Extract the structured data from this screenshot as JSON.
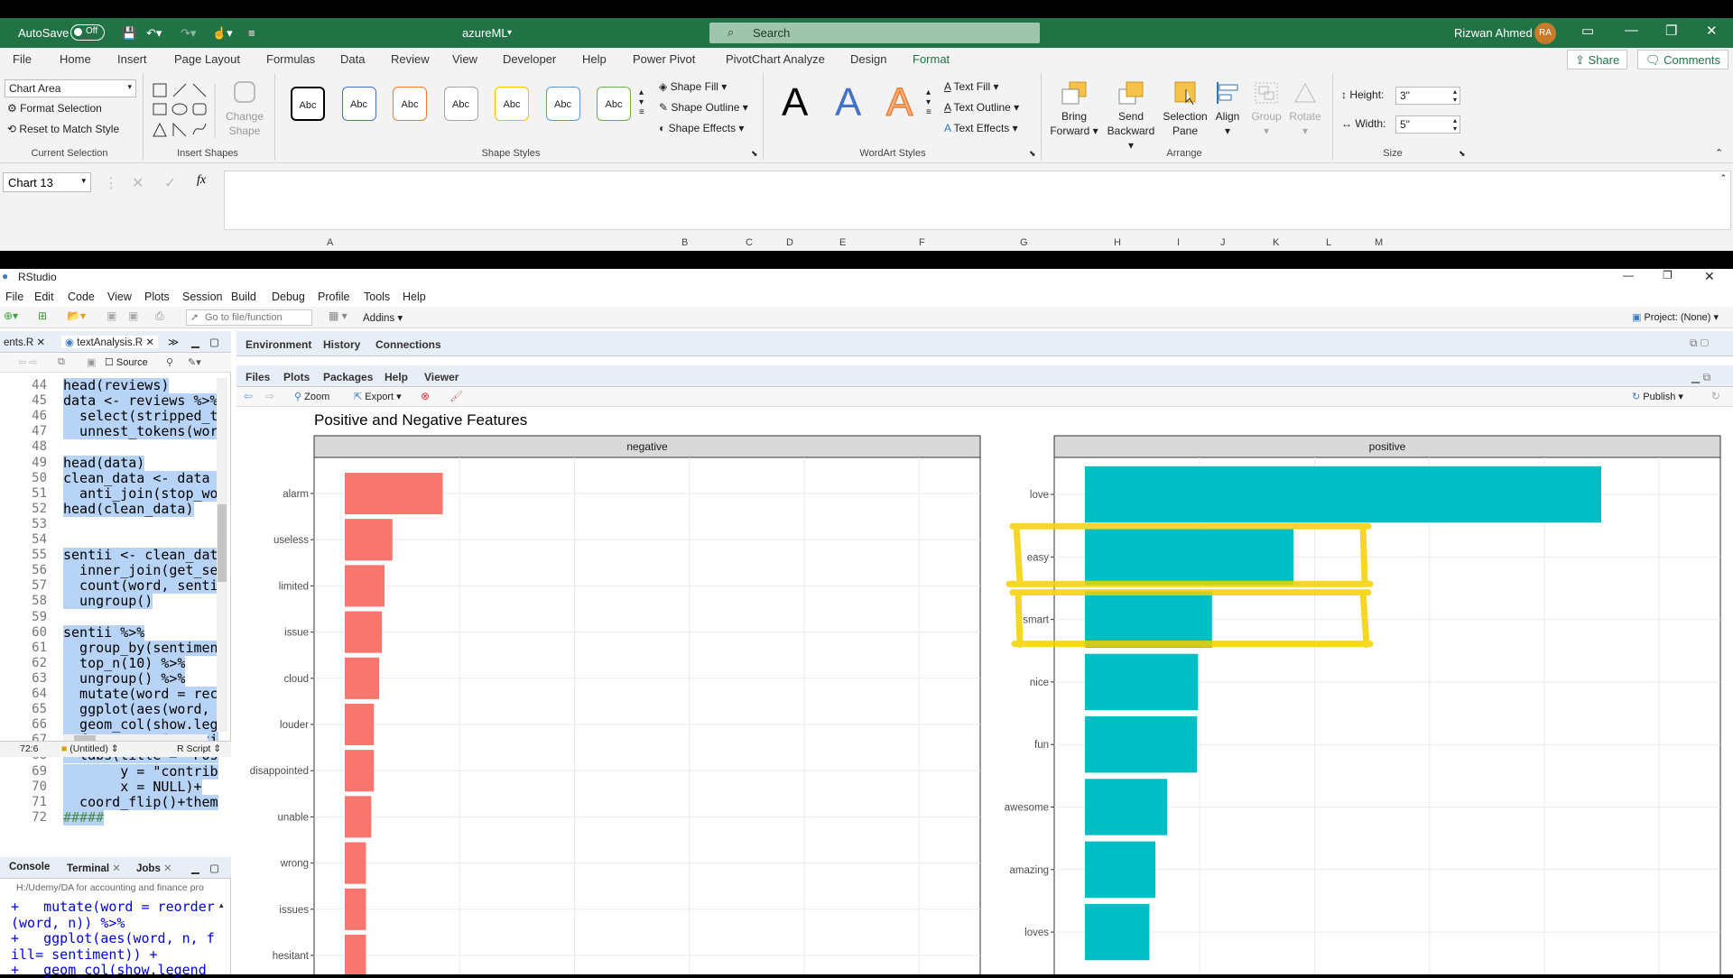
{
  "excel": {
    "autosave_label": "AutoSave",
    "autosave_state": "Off",
    "file_name": "azureML",
    "search_placeholder": "Search",
    "user_name": "Rizwan Ahmed",
    "user_initials": "RA",
    "menu_tabs": [
      "File",
      "Home",
      "Insert",
      "Page Layout",
      "Formulas",
      "Data",
      "Review",
      "View",
      "Developer",
      "Help",
      "Power Pivot",
      "PivotChart Analyze",
      "Design",
      "Format"
    ],
    "active_tab": "Format",
    "share_label": "Share",
    "comments_label": "Comments",
    "current_selection": {
      "dropdown_value": "Chart Area",
      "format_selection": "Format Selection",
      "reset_style": "Reset to Match Style",
      "group_label": "Current Selection"
    },
    "insert_shapes": {
      "change_shape_1": "Change",
      "change_shape_2": "Shape",
      "group_label": "Insert Shapes"
    },
    "shape_styles": {
      "swatches": [
        "Abc",
        "Abc",
        "Abc",
        "Abc",
        "Abc",
        "Abc",
        "Abc"
      ],
      "swatch_colors": [
        "#000000",
        "#4472c4",
        "#ed7d31",
        "#a5a5a5",
        "#ffc000",
        "#5b9bd5",
        "#70ad47"
      ],
      "shape_fill": "Shape Fill",
      "shape_outline": "Shape Outline",
      "shape_effects": "Shape Effects",
      "group_label": "Shape Styles"
    },
    "wordart": {
      "letters": [
        "A",
        "A",
        "A"
      ],
      "text_fill": "Text Fill",
      "text_outline": "Text Outline",
      "text_effects": "Text Effects",
      "group_label": "WordArt Styles"
    },
    "arrange": {
      "bring_forward_1": "Bring",
      "bring_forward_2": "Forward",
      "send_backward_1": "Send",
      "send_backward_2": "Backward",
      "selection_pane_1": "Selection",
      "selection_pane_2": "Pane",
      "align": "Align",
      "group": "Group",
      "rotate": "Rotate",
      "group_label": "Arrange"
    },
    "size": {
      "height_label": "Height:",
      "height_value": "3\"",
      "width_label": "Width:",
      "width_value": "5\"",
      "group_label": "Size"
    },
    "name_box": "Chart 13",
    "fx": "fx",
    "columns": [
      "A",
      "B",
      "C",
      "D",
      "E",
      "F",
      "G",
      "H",
      "I",
      "J",
      "K",
      "L",
      "M"
    ]
  },
  "rstudio": {
    "app_title": "RStudio",
    "menu": [
      "File",
      "Edit",
      "Code",
      "View",
      "Plots",
      "Session",
      "Build",
      "Debug",
      "Profile",
      "Tools",
      "Help"
    ],
    "goto_placeholder": "Go to file/function",
    "addins": "Addins",
    "project": "Project: (None)",
    "source_tabs": [
      "ents.R",
      "textAnalysis.R"
    ],
    "source_label": "Source",
    "code_lines": [
      {
        "n": "44",
        "t": "head(reviews)"
      },
      {
        "n": "45",
        "t": "data <- reviews %>%"
      },
      {
        "n": "46",
        "t": "  select(stripped_t"
      },
      {
        "n": "47",
        "t": "  unnest_tokens(wor"
      },
      {
        "n": "48",
        "t": ""
      },
      {
        "n": "49",
        "t": "head(data)"
      },
      {
        "n": "50",
        "t": "clean_data <- data "
      },
      {
        "n": "51",
        "t": "  anti_join(stop_wo"
      },
      {
        "n": "52",
        "t": "head(clean_data)"
      },
      {
        "n": "53",
        "t": ""
      },
      {
        "n": "54",
        "t": ""
      },
      {
        "n": "55",
        "t": "sentii <- clean_dat"
      },
      {
        "n": "56",
        "t": "  inner_join(get_se"
      },
      {
        "n": "57",
        "t": "  count(word, senti"
      },
      {
        "n": "58",
        "t": "  ungroup()"
      },
      {
        "n": "59",
        "t": ""
      },
      {
        "n": "60",
        "t": "sentii %>%"
      },
      {
        "n": "61",
        "t": "  group_by(sentimen"
      },
      {
        "n": "62",
        "t": "  top_n(10) %>%"
      },
      {
        "n": "63",
        "t": "  ungroup() %>%"
      },
      {
        "n": "64",
        "t": "  mutate(word = rec"
      },
      {
        "n": "65",
        "t": "  ggplot(aes(word, "
      },
      {
        "n": "66",
        "t": "  geom_col(show.leg"
      },
      {
        "n": "67",
        "t": "  facet_wrap(~senti"
      },
      {
        "n": "68",
        "t": "  labs(title = \"Pos"
      },
      {
        "n": "69",
        "t": "       y = \"contrib"
      },
      {
        "n": "70",
        "t": "       x = NULL)+"
      },
      {
        "n": "71",
        "t": "  coord_flip()+them"
      },
      {
        "n": "72",
        "t": "#####"
      }
    ],
    "cursor_pos": "72:6",
    "scope": "(Untitled)",
    "file_type": "R Script",
    "console_tabs": [
      "Console",
      "Terminal",
      "Jobs"
    ],
    "console_path": "H:/Udemy/DA for accounting and finance pro",
    "console_lines": [
      "+   mutate(word = reorder",
      "(word, n)) %>%",
      "+   ggplot(aes(word, n, f",
      "ill= sentiment)) +",
      "+   geom_col(show.legend"
    ],
    "env_tabs": [
      "Environment",
      "History",
      "Connections"
    ],
    "files_tabs": [
      "Files",
      "Plots",
      "Packages",
      "Help",
      "Viewer"
    ],
    "active_files_tab": "Plots",
    "zoom": "Zoom",
    "export": "Export",
    "publish": "Publish"
  },
  "chart_data": {
    "type": "bar",
    "title": "Positive and Negative Features",
    "orientation": "horizontal",
    "facets": [
      {
        "name": "negative",
        "color": "#f8766d",
        "categories": [
          "alarm",
          "useless",
          "limited",
          "issue",
          "cloud",
          "louder",
          "disappointed",
          "unable",
          "wrong",
          "issues",
          "hesitant"
        ],
        "values": [
          37,
          18,
          15,
          14,
          13,
          11,
          11,
          10,
          8,
          8,
          8
        ]
      },
      {
        "name": "positive",
        "color": "#00bfc4",
        "categories": [
          "love",
          "easy",
          "smart",
          "nice",
          "fun",
          "awesome",
          "amazing",
          "loves"
        ],
        "values": [
          520,
          210,
          128,
          114,
          113,
          83,
          71,
          65
        ]
      }
    ],
    "grid": true,
    "highlight_color": "#f5d000"
  }
}
